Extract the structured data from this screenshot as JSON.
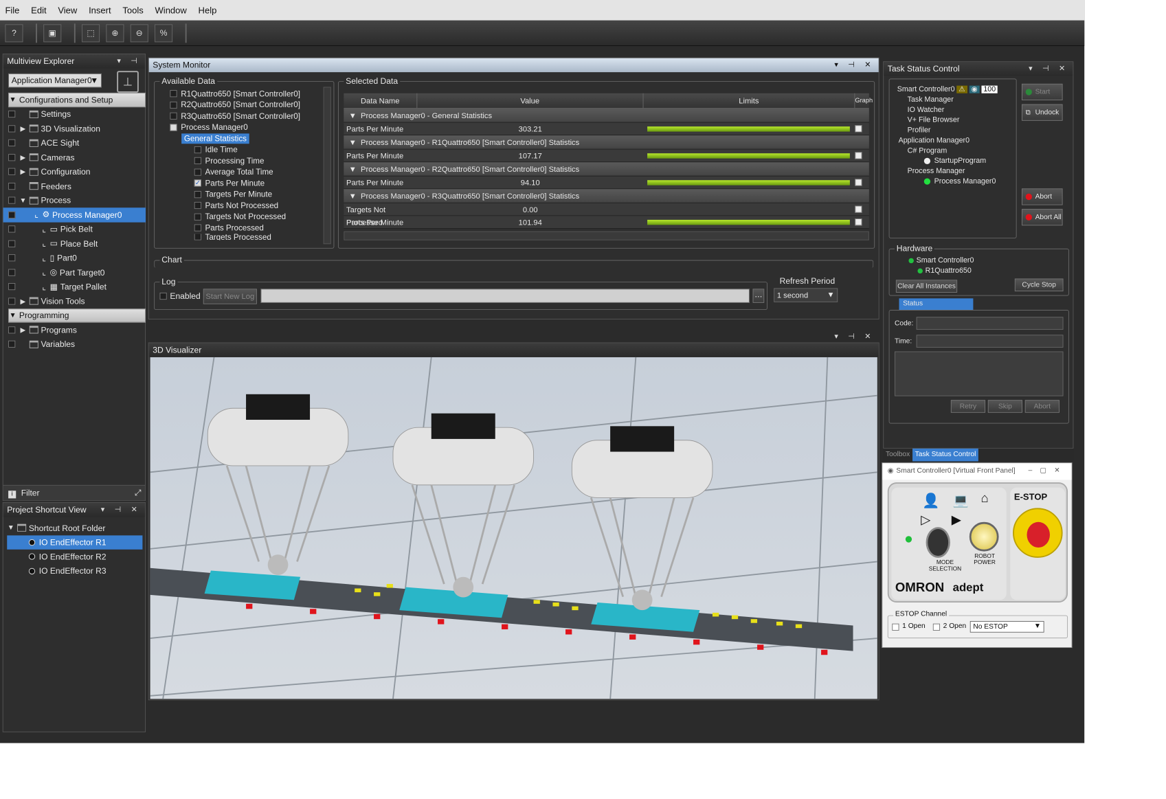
{
  "menu": [
    "File",
    "Edit",
    "View",
    "Insert",
    "Tools",
    "Window",
    "Help"
  ],
  "explorer": {
    "title": "Multiview Explorer",
    "app_select": "Application Manager0",
    "config_header": "Configurations and Setup",
    "items": [
      "Settings",
      "3D Visualization",
      "ACE Sight",
      "Cameras",
      "Configuration",
      "Feeders",
      "Process",
      "Process Manager0",
      "Pick Belt",
      "Place Belt",
      "Part0",
      "Part Target0",
      "Target Pallet",
      "Vision Tools"
    ],
    "prog_header": "Programming",
    "prog_items": [
      "Programs",
      "Variables"
    ],
    "filter": "Filter"
  },
  "shortcut": {
    "title": "Project Shortcut View",
    "root": "Shortcut Root Folder",
    "items": [
      "IO EndEffector R1",
      "IO EndEffector R2",
      "IO EndEffector R3"
    ]
  },
  "sysmon": {
    "title": "System Monitor",
    "available_label": "Available Data",
    "available": [
      "R1Quattro650 [Smart Controller0]",
      "R2Quattro650 [Smart Controller0]",
      "R3Quattro650 [Smart Controller0]",
      "Process Manager0",
      "General Statistics",
      "Idle Time",
      "Processing Time",
      "Average Total Time",
      "Parts Per Minute",
      "Targets Per Minute",
      "Parts Not Processed",
      "Targets Not Processed",
      "Parts Processed",
      "Targets Processed"
    ],
    "selected_label": "Selected Data",
    "cols": [
      "Data Name",
      "Value",
      "Limits",
      "Graph"
    ],
    "groups": [
      {
        "name": "Process Manager0 - General Statistics",
        "rows": [
          {
            "n": "Parts Per Minute",
            "v": "303.21"
          }
        ]
      },
      {
        "name": "Process Manager0 - R1Quattro650 [Smart Controller0] Statistics",
        "rows": [
          {
            "n": "Parts Per Minute",
            "v": "107.17"
          }
        ]
      },
      {
        "name": "Process Manager0 - R2Quattro650 [Smart Controller0] Statistics",
        "rows": [
          {
            "n": "Parts Per Minute",
            "v": "94.10"
          }
        ]
      },
      {
        "name": "Process Manager0 - R3Quattro650 [Smart Controller0] Statistics",
        "rows": [
          {
            "n": "Targets Not Processed",
            "v": "0.00"
          },
          {
            "n": "Parts Per Minute",
            "v": "101.94"
          }
        ]
      }
    ],
    "chart_label": "Chart",
    "log_label": "Log",
    "enabled": "Enabled",
    "start_log": "Start New Log",
    "refresh_label": "Refresh Period",
    "refresh_value": "1 second"
  },
  "visualizer": {
    "title": "3D Visualizer"
  },
  "task": {
    "title": "Task Status Control",
    "controller": "Smart Controller0",
    "speed": "100",
    "tree": [
      "Task Manager",
      "IO Watcher",
      "V+ File Browser",
      "Profiler",
      "Application Manager0",
      "C# Program",
      "StartupProgram",
      "Process Manager",
      "Process Manager0"
    ],
    "start": "Start",
    "undock": "Undock",
    "abort": "Abort",
    "abort_all": "Abort All",
    "hardware_label": "Hardware",
    "hw_items": [
      "Smart Controller0",
      "R1Quattro650"
    ],
    "clear": "Clear All Instances",
    "cycle_stop": "Cycle Stop",
    "status_tab": "Status",
    "code": "Code:",
    "time": "Time:",
    "retry": "Retry",
    "skip": "Skip",
    "abort2": "Abort",
    "tabs": [
      "Toolbox",
      "Task Status Control"
    ]
  },
  "vfp": {
    "title": "Smart Controller0 [Virtual Front Panel]",
    "mode": "MODE SELECTION",
    "robot_power": "ROBOT POWER",
    "estop": "E-STOP",
    "omron": "OMRON",
    "adept": "adept",
    "channel_label": "ESTOP Channel",
    "open1": "1 Open",
    "open2": "2 Open",
    "no_estop": "No ESTOP"
  }
}
